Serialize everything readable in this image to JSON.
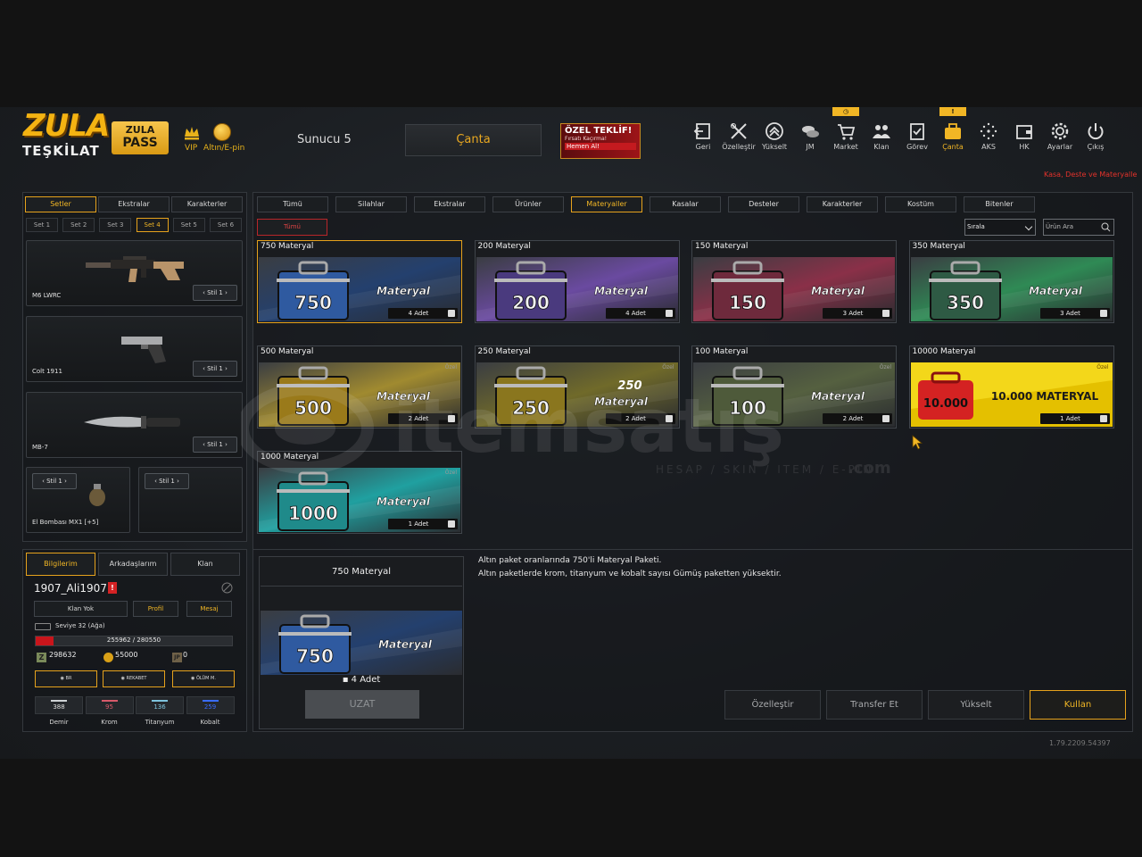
{
  "header": {
    "logo_line1": "ZULA",
    "logo_line2": "TEŞKİLAT",
    "pass_line1": "ZULA",
    "pass_line2": "PASS",
    "vip_label": "VIP",
    "gold_label": "Altın/E-pin",
    "server": "Sunucu 5",
    "current_page": "Çanta",
    "offer_title": "ÖZEL TEKLİF!",
    "offer_sub": "Fırsatı Kaçırma!",
    "offer_cta": "Hemen Al!",
    "promo_link": "Kasa, Deste ve Materyalle",
    "nav": [
      {
        "label": "Geri",
        "icon": "back-icon"
      },
      {
        "label": "Özelleştir",
        "icon": "tools-icon"
      },
      {
        "label": "Yükselt",
        "icon": "upgrade-icon"
      },
      {
        "label": "JM",
        "icon": "coins-icon"
      },
      {
        "label": "Market",
        "icon": "cart-icon",
        "flag": "◷"
      },
      {
        "label": "Klan",
        "icon": "clan-icon"
      },
      {
        "label": "Görev",
        "icon": "mission-icon"
      },
      {
        "label": "Çanta",
        "icon": "bag-icon",
        "flag": "!",
        "active": true
      },
      {
        "label": "AKS",
        "icon": "aks-icon"
      },
      {
        "label": "HK",
        "icon": "wallet-icon"
      },
      {
        "label": "Ayarlar",
        "icon": "gear-icon"
      },
      {
        "label": "Çıkış",
        "icon": "power-icon"
      }
    ]
  },
  "left": {
    "tabs": [
      "Setler",
      "Ekstralar",
      "Karakterler"
    ],
    "sets": [
      "Set 1",
      "Set 2",
      "Set 3",
      "Set 4",
      "Set 5",
      "Set 6"
    ],
    "active_set": "Set 4",
    "weapons": [
      {
        "name": "M6 LWRC",
        "style": "Stil 1"
      },
      {
        "name": "Colt 1911",
        "style": "Stil 1"
      },
      {
        "name": "MB-7",
        "style": "Stil 1"
      }
    ],
    "grenade": {
      "name": "El Bombası MX1 [+5]",
      "style": "Stil 1"
    },
    "empty_style": "Stil 1"
  },
  "profile": {
    "tabs": [
      "Bilgilerim",
      "Arkadaşlarım",
      "Klan"
    ],
    "name": "1907_Ali1907",
    "badge": "!",
    "buttons": [
      "Klan Yok",
      "Profil",
      "Mesaj"
    ],
    "level": "Seviye 32 (Ağa)",
    "xp_text": "255962 / 280550",
    "xp_fraction": 0.09,
    "z_currency": "298632",
    "gold": "55000",
    "jp": "0",
    "ranks": [
      "BR",
      "REKABET",
      "ÖLÜM M."
    ],
    "materials": [
      {
        "name": "Demir",
        "value": "388",
        "color": "#cfd3d6"
      },
      {
        "name": "Krom",
        "value": "95",
        "color": "#d85a6a"
      },
      {
        "name": "Titanyum",
        "value": "136",
        "color": "#7fc4dd"
      },
      {
        "name": "Kobalt",
        "value": "259",
        "color": "#3a6cff"
      }
    ]
  },
  "categories": [
    "Tümü",
    "Silahlar",
    "Ekstralar",
    "Ürünler",
    "Materyaller",
    "Kasalar",
    "Desteler",
    "Karakterler",
    "Kostüm",
    "Bitenler"
  ],
  "active_category": "Materyaller",
  "sub_filter": "Tümü",
  "sort_label": "Sırala",
  "search_placeholder": "Ürün Ara",
  "items": [
    {
      "title": "750 Materyal",
      "count": "4 Adet",
      "num": "750",
      "word": "Materyal",
      "color": "#2f5aa0",
      "tint": "#24406e"
    },
    {
      "title": "200 Materyal",
      "count": "4 Adet",
      "num": "200",
      "word": "Materyal",
      "color": "#4a3a7e",
      "tint": "#6a4aa0"
    },
    {
      "title": "150 Materyal",
      "count": "3 Adet",
      "num": "150",
      "word": "Materyal",
      "color": "#6e2a3c",
      "tint": "#8a3048"
    },
    {
      "title": "350 Materyal",
      "count": "3 Adet",
      "num": "350",
      "word": "Materyal",
      "color": "#2e5a44",
      "tint": "#2f8a55"
    },
    {
      "title": "500 Materyal",
      "count": "2 Adet",
      "num": "500",
      "word": "Materyal",
      "color": "#9a7a1a",
      "tint": "#a08a30",
      "special": "Özel"
    },
    {
      "title": "250 Materyal",
      "count": "2 Adet",
      "num": "250",
      "word": "Materyal",
      "color": "#8a761e",
      "tint": "#706a2a",
      "special": "Özel",
      "extra": "250"
    },
    {
      "title": "100 Materyal",
      "count": "2 Adet",
      "num": "100",
      "word": "Materyal",
      "color": "#4e5a3a",
      "tint": "#556040",
      "special": "Özel"
    },
    {
      "title": "10000 Materyal",
      "count": "1 Adet",
      "num": "10.000",
      "word": "10.000 MATERYAL",
      "color": "#d42222",
      "tint": "#e8c200",
      "special": "Özel",
      "big": true
    },
    {
      "title": "1000 Materyal",
      "count": "1 Adet",
      "num": "1000",
      "word": "Materyal",
      "color": "#1f8a8a",
      "tint": "#20a0a0",
      "special": "Özel"
    }
  ],
  "detail": {
    "title": "750 Materyal",
    "num": "750",
    "word": "Materyal",
    "count": "4 Adet",
    "extend": "UZAT",
    "desc1": "Altın paket oranlarında 750'li Materyal Paketi.",
    "desc2": "Altın paketlerde krom, titanyum ve kobalt sayısı Gümüş paketten yüksektir."
  },
  "actions": [
    "Özelleştir",
    "Transfer Et",
    "Yükselt",
    "Kullan"
  ],
  "watermark": {
    "brand": "itemsatış",
    "tagline": "HESAP / SKIN / ITEM / E-PIN",
    "tld": ".com"
  },
  "version": "1.79.2209.54397"
}
